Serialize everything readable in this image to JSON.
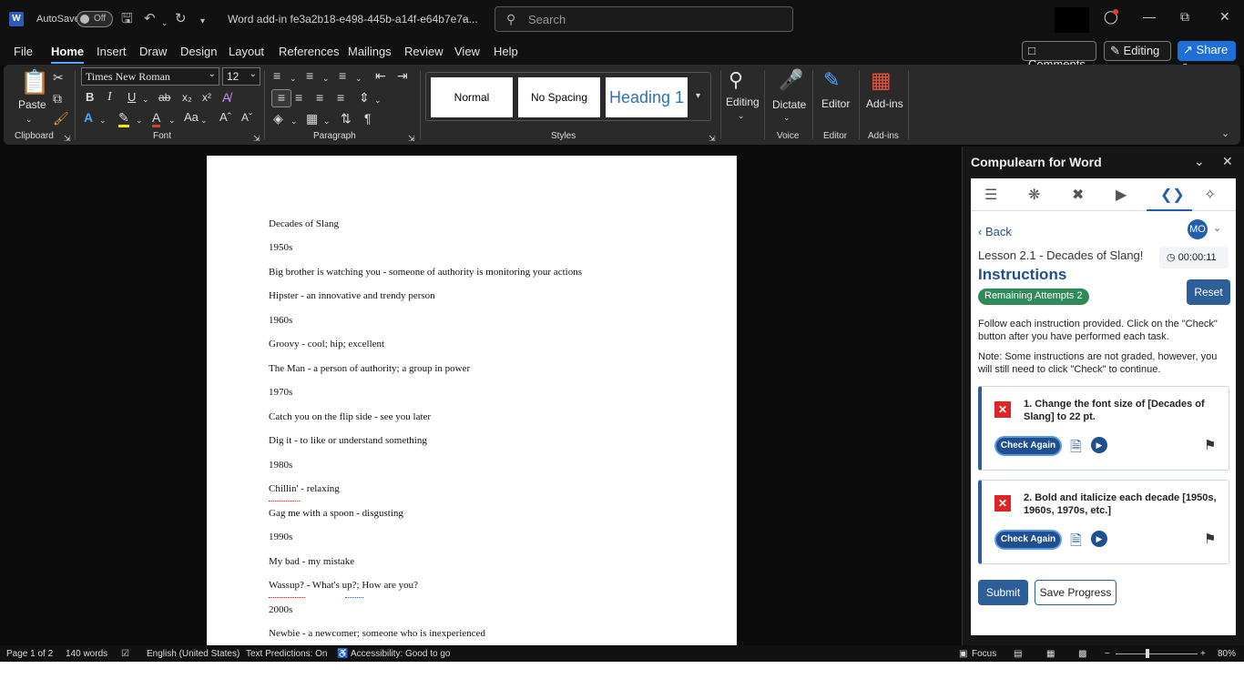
{
  "titlebar": {
    "autosave_label": "AutoSave",
    "autosave_state": "Off",
    "document_title": "Word add-in fe3a2b18-e498-445b-a14f-e64b7e7a...",
    "search_placeholder": "Search"
  },
  "menu": {
    "tabs": [
      "File",
      "Home",
      "Insert",
      "Draw",
      "Design",
      "Layout",
      "References",
      "Mailings",
      "Review",
      "View",
      "Help"
    ],
    "active_tab": "Home",
    "comments_label": "Comments",
    "editing_label": "Editing",
    "share_label": "Share"
  },
  "ribbon": {
    "paste_label": "Paste",
    "font_name": "Times New Roman",
    "font_size": "12",
    "groups": {
      "clipboard": "Clipboard",
      "font": "Font",
      "paragraph": "Paragraph",
      "styles": "Styles",
      "voice": "Voice",
      "editor": "Editor",
      "addins": "Add-ins"
    },
    "styles": [
      "Normal",
      "No Spacing",
      "Heading 1"
    ],
    "editing_btn": "Editing",
    "dictate_btn": "Dictate",
    "editor_btn": "Editor",
    "addins_btn": "Add-ins"
  },
  "document": {
    "lines": [
      "Decades of Slang",
      "1950s",
      "Big brother is watching you - someone of authority is monitoring your actions",
      "Hipster - an innovative and trendy person",
      "1960s",
      "Groovy - cool; hip; excellent",
      "The Man - a person of authority; a group in power",
      "1970s",
      "Catch you on the flip side - see you later",
      "Dig it - to like or understand something",
      "1980s",
      "Chillin' - relaxing",
      "Gag me with a spoon - disgusting",
      "1990s",
      "My bad - my mistake",
      "Wassup? - What's up?; How are you?",
      "2000s",
      "Newbie - a newcomer; someone who is inexperienced"
    ]
  },
  "pane": {
    "title": "Compulearn for Word",
    "back_label": "Back",
    "avatar_initials": "MO",
    "lesson_name": "Lesson 2.1 - Decades of Slang!",
    "timer": "00:00:11",
    "instructions_heading": "Instructions",
    "remaining_attempts": "Remaining Attempts 2",
    "reset_label": "Reset",
    "intro_text": "Follow each instruction provided. Click on the \"Check\" button after you have performed each task.",
    "note_text": "Note: Some instructions are not graded, however, you will still need to click \"Check\" to continue.",
    "tasks": [
      {
        "text": "1. Change the font size of [Decades of Slang] to 22 pt.",
        "button": "Check Again"
      },
      {
        "text": "2. Bold and italicize each decade [1950s, 1960s, 1970s, etc.]",
        "button": "Check Again"
      }
    ],
    "submit_label": "Submit",
    "save_progress_label": "Save Progress"
  },
  "status": {
    "page": "Page 1 of 2",
    "words": "140 words",
    "language": "English (United States)",
    "text_predictions": "Text Predictions: On",
    "accessibility": "Accessibility: Good to go",
    "focus": "Focus",
    "zoom": "80%"
  },
  "colors": {
    "accent": "#1e6fd9",
    "pane_blue": "#2d5e99",
    "error_red": "#e02424",
    "attempts_green": "#2e8b57"
  }
}
